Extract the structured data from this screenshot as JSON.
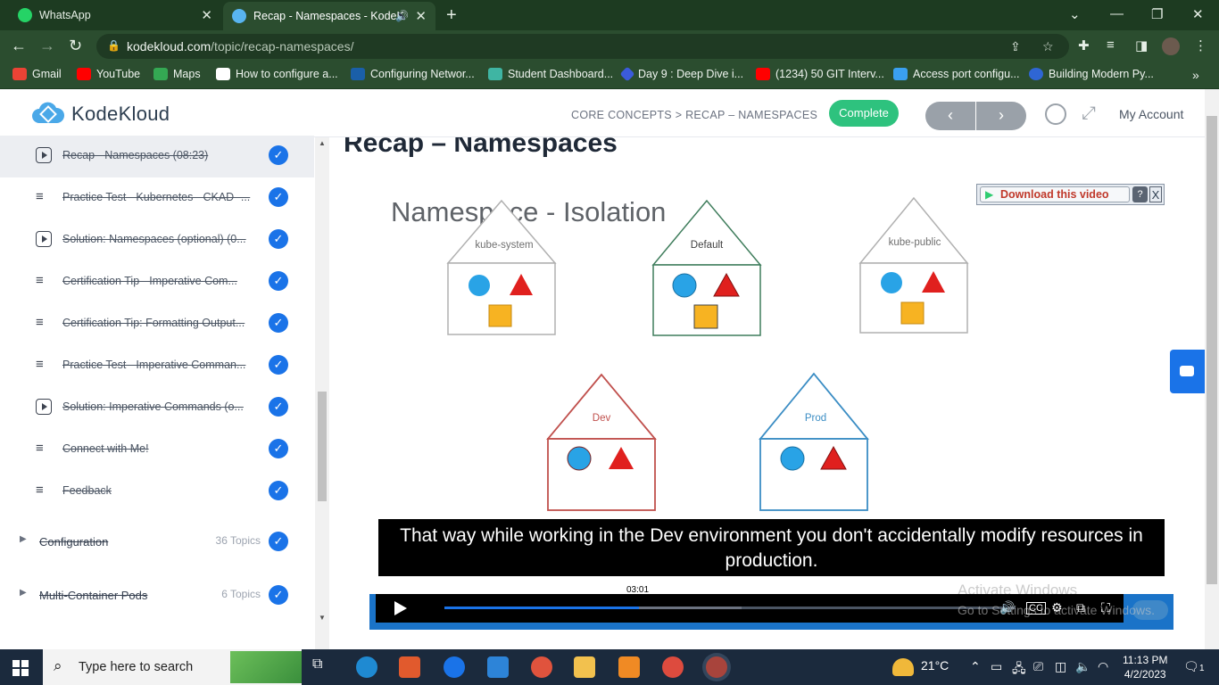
{
  "browser": {
    "tabs": [
      {
        "title": "WhatsApp",
        "active": false
      },
      {
        "title": "Recap - Namespaces - KodeK",
        "active": true
      }
    ],
    "url_host": "kodekloud.com",
    "url_path": "/topic/recap-namespaces/",
    "bookmarks": [
      {
        "label": "Gmail",
        "icon": "gmail-icon"
      },
      {
        "label": "YouTube",
        "icon": "youtube-icon"
      },
      {
        "label": "Maps",
        "icon": "maps-icon"
      },
      {
        "label": "How to configure a...",
        "icon": "page-icon"
      },
      {
        "label": "Configuring Networ...",
        "icon": "vmware-icon"
      },
      {
        "label": "Student Dashboard...",
        "icon": "cloud-icon"
      },
      {
        "label": "Day 9 : Deep Dive i...",
        "icon": "diamond-icon"
      },
      {
        "label": "(1234) 50 GIT Interv...",
        "icon": "youtube-icon"
      },
      {
        "label": "Access port configu...",
        "icon": "link-icon"
      },
      {
        "label": "Building Modern Py...",
        "icon": "c-icon"
      }
    ]
  },
  "header": {
    "brand": "KodeKloud",
    "breadcrumb": "CORE CONCEPTS > RECAP – NAMESPACES",
    "complete_label": "Complete",
    "prev_label": "‹",
    "next_label": "›",
    "account_label": "My Account"
  },
  "sidebar": {
    "lessons": [
      {
        "title": "Recap - Namespaces (08:23)",
        "type": "video",
        "current": true
      },
      {
        "title": "Practice Test - Kubernetes - CKAD -...",
        "type": "doc"
      },
      {
        "title": "Solution: Namespaces (optional) (0...",
        "type": "video"
      },
      {
        "title": "Certification Tip - Imperative Com...",
        "type": "doc"
      },
      {
        "title": "Certification Tip: Formatting Output...",
        "type": "doc"
      },
      {
        "title": "Practice Test - Imperative Comman...",
        "type": "doc"
      },
      {
        "title": "Solution: Imperative Commands (o...",
        "type": "video"
      },
      {
        "title": "Connect with Me!",
        "type": "doc"
      },
      {
        "title": "Feedback",
        "type": "doc"
      }
    ],
    "sections": [
      {
        "title": "Configuration",
        "count": "36 Topics"
      },
      {
        "title": "Multi-Container Pods",
        "count": "6 Topics"
      }
    ],
    "check_glyph": "✓"
  },
  "main": {
    "lesson_title": "Recap – Namespaces",
    "slide": {
      "heading": "Namespace - Isolation",
      "houses": [
        {
          "label": "kube-system",
          "color": "#9e9e9e"
        },
        {
          "label": "Default",
          "color": "#3f7d5c"
        },
        {
          "label": "kube-public",
          "color": "#9e9e9e"
        },
        {
          "label": "Dev",
          "color": "#c0504d"
        },
        {
          "label": "Prod",
          "color": "#3b8dc4"
        }
      ]
    },
    "download": {
      "label": "Download this video",
      "help": "?",
      "close": "X"
    },
    "caption": "That way while working in the Dev environment you don't accidentally modify resources in production.",
    "player": {
      "time": "03:01",
      "progress": 0.34,
      "buffered": 0.52
    },
    "watermark": {
      "line1": "Activate Windows",
      "line2": "Go to Settings to activate Windows."
    }
  },
  "taskbar": {
    "search_placeholder": "Type here to search",
    "temperature": "21°C",
    "time": "11:13 PM",
    "date": "4/2/2023",
    "notification_count": "1"
  },
  "colors": {
    "brand_green": "#2ec27e",
    "check_blue": "#1a73e8",
    "browser_dark": "#1d3b21",
    "browser_mid": "#2b4d2f"
  }
}
